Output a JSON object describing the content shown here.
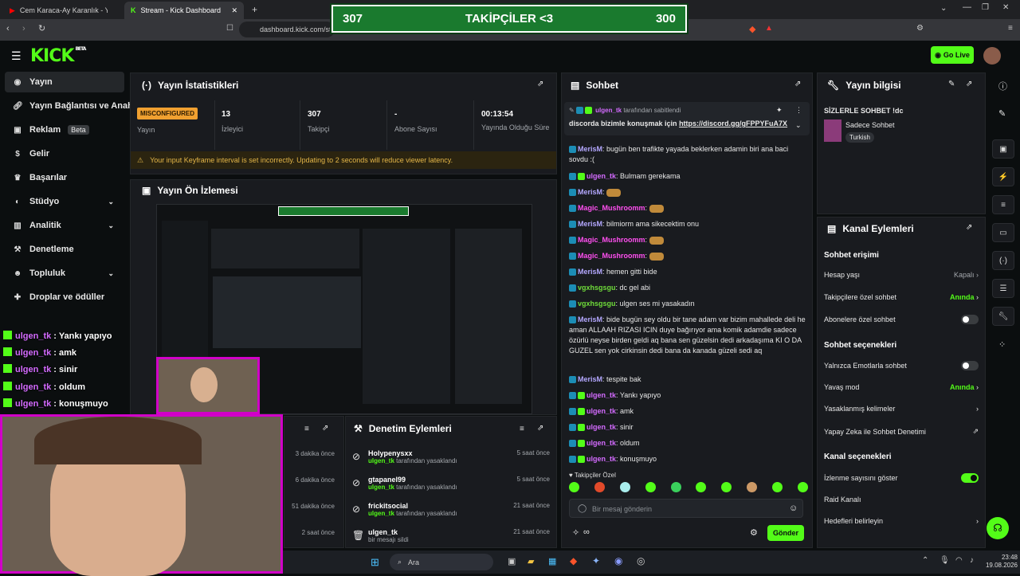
{
  "browser": {
    "tabs": [
      {
        "label": "Cem Karaca-Ay Karanlık - YouTube"
      },
      {
        "label": "Stream - Kick Dashboard"
      }
    ],
    "url": "dashboard.kick.com/str"
  },
  "overlay": {
    "left_value": "307",
    "title": "TAKİPÇİLER <3",
    "right_value": "300",
    "lines": [
      {
        "name": "ulgen_tk",
        "text": ": Yankı yapıyo"
      },
      {
        "name": "ulgen_tk",
        "text": ": amk"
      },
      {
        "name": "ulgen_tk",
        "text": ": sinir"
      },
      {
        "name": "ulgen_tk",
        "text": ": oldum"
      },
      {
        "name": "ulgen_tk",
        "text": ": konuşmuyo"
      }
    ]
  },
  "header": {
    "logo": "KICK",
    "logo_tag": "BETA",
    "go_live": "Go Live"
  },
  "sidebar": {
    "items": [
      {
        "label": "Yayın",
        "icon": "broadcast-icon"
      },
      {
        "label": "Yayın Bağlantısı ve Anahtar",
        "icon": "link-icon"
      },
      {
        "label": "Reklam",
        "icon": "ad-icon",
        "badge": "Beta"
      },
      {
        "label": "Gelir",
        "icon": "money-icon"
      },
      {
        "label": "Başarılar",
        "icon": "trophy-icon"
      },
      {
        "label": "Stüdyo",
        "icon": "palette-icon"
      },
      {
        "label": "Analitik",
        "icon": "chart-icon"
      },
      {
        "label": "Denetleme",
        "icon": "hammer-icon"
      },
      {
        "label": "Topluluk",
        "icon": "users-icon"
      },
      {
        "label": "Droplar ve ödüller",
        "icon": "gift-icon"
      }
    ]
  },
  "stats": {
    "title": "Yayın İstatistikleri",
    "items": [
      {
        "value": "MISCONFIGURED",
        "label": "Yayın"
      },
      {
        "value": "13",
        "label": "İzleyici"
      },
      {
        "value": "307",
        "label": "Takipçi"
      },
      {
        "value": "-",
        "label": "Abone Sayısı"
      },
      {
        "value": "00:13:54",
        "label": "Yayında Olduğu Süre"
      }
    ],
    "warning": "Your input Keyframe interval is set incorrectly. Updating to 2 seconds will reduce viewer latency."
  },
  "preview": {
    "title": "Yayın Ön İzlemesi"
  },
  "chat": {
    "title": "Sohbet",
    "pinned_by": "ulgen_tk",
    "pinned_by_suffix": "tarafından sabitlendi",
    "pinned_text": "discorda bizimle konuşmak için",
    "pinned_link": "https://discord.gg/gFPPYFuA7X",
    "messages": [
      {
        "user": "MerisM",
        "color": "#b4a8ff",
        "text": "bugün ben trafikte yayada beklerken adamin biri ana baci sovdu :("
      },
      {
        "user": "ulgen_tk",
        "color": "#d46bff",
        "text": "Bulmam gerekama"
      },
      {
        "user": "MerisM",
        "color": "#b4a8ff",
        "text": ""
      },
      {
        "user": "Magic_Mushroomm",
        "color": "#ff4ff0",
        "text": ""
      },
      {
        "user": "MerisM",
        "color": "#b4a8ff",
        "text": "bilmiorm ama sikecektim onu"
      },
      {
        "user": "Magic_Mushroomm",
        "color": "#ff4ff0",
        "text": ""
      },
      {
        "user": "Magic_Mushroomm",
        "color": "#ff4ff0",
        "text": ""
      },
      {
        "user": "MerisM",
        "color": "#b4a8ff",
        "text": "hemen gitti bide"
      },
      {
        "user": "vgxhsgsgu",
        "color": "#6fdc3a",
        "text": "dc gel abi"
      },
      {
        "user": "vgxhsgsgu",
        "color": "#6fdc3a",
        "text": "ulgen ses mi yasakadın"
      },
      {
        "user": "MerisM",
        "color": "#b4a8ff",
        "text": "bide bugün sey oldu bir tane adam var bizim mahallede deli he aman ALLAAH RIZASI ICIN duye bağırıyor ama komik adamdie sadece özürlü neyse birden geldi aq bana sen güzelsin dedi arkadaşıma KI O DA GUZEL sen yok cirkinsin dedi bana da kanada güzeli sedi aq"
      },
      {
        "user": "MerisM",
        "color": "#b4a8ff",
        "text": "tespite bak"
      },
      {
        "user": "ulgen_tk",
        "color": "#d46bff",
        "text": "Yankı yapıyo"
      },
      {
        "user": "ulgen_tk",
        "color": "#d46bff",
        "text": "amk"
      },
      {
        "user": "ulgen_tk",
        "color": "#d46bff",
        "text": "sinir"
      },
      {
        "user": "ulgen_tk",
        "color": "#d46bff",
        "text": "oldum"
      },
      {
        "user": "ulgen_tk",
        "color": "#d46bff",
        "text": "konuşmuyo"
      }
    ],
    "followers_label": "Takipçiler Özel",
    "input_placeholder": "Bir mesaj gönderin",
    "send_label": "Gönder"
  },
  "stream_info": {
    "title": "Yayın bilgisi",
    "stream_title": "SİZLERLE SOHBET !dc",
    "category": "Sadece Sohbet",
    "tag": "Turkish"
  },
  "channel_actions": {
    "title": "Kanal Eylemleri",
    "chat_access": "Sohbet erişimi",
    "rows_access": [
      {
        "label": "Hesap yaşı",
        "value": "Kapalı"
      },
      {
        "label": "Takipçilere özel sohbet",
        "value": "Anında"
      },
      {
        "label": "Abonelere özel sohbet",
        "value": ""
      }
    ],
    "chat_options": "Sohbet seçenekleri",
    "rows_options": [
      {
        "label": "Yalnızca Emotlarla sohbet",
        "value": ""
      },
      {
        "label": "Yavaş mod",
        "value": "Anında"
      },
      {
        "label": "Yasaklanmış kelimeler",
        "value": ""
      },
      {
        "label": "Yapay Zeka ile Sohbet Denetimi",
        "value": ""
      }
    ],
    "channel_options": "Kanal seçenekleri",
    "rows_channel": [
      {
        "label": "İzlenme sayısını göster",
        "value": ""
      },
      {
        "label": "Raid Kanalı",
        "value": ""
      },
      {
        "label": "Hedefleri belirleyin",
        "value": ""
      }
    ]
  },
  "mod_actions": {
    "title": "Denetim Eylemleri",
    "left_times": [
      "3 dakika önce",
      "6 dakika önce",
      "51 dakika önce",
      "2 saat önce"
    ],
    "items": [
      {
        "name": "Holypenysxx",
        "by": "ulgen_tk",
        "action": "tarafından yasaklandı",
        "time": "5 saat önce"
      },
      {
        "name": "gtapanel99",
        "by": "ulgen_tk",
        "action": "tarafından yasaklandı",
        "time": "5 saat önce"
      },
      {
        "name": "frickitsocial",
        "by": "ulgen_tk",
        "action": "tarafından yasaklandı",
        "time": "21 saat önce"
      },
      {
        "name": "ulgen_tk",
        "by": "",
        "action": "bir mesajı sildi",
        "time": "21 saat önce"
      }
    ]
  },
  "taskbar": {
    "search": "Ara",
    "time": "23:48",
    "date": "19.08.2026"
  }
}
